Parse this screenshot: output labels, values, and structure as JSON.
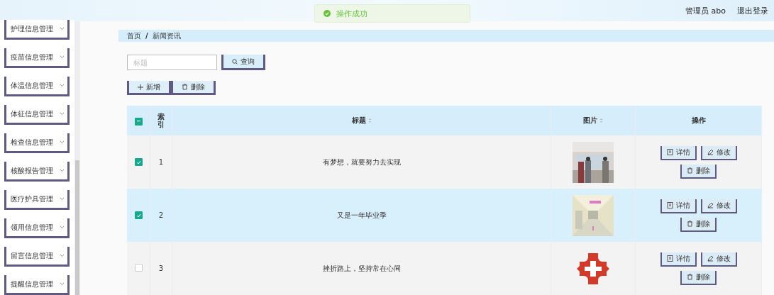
{
  "header": {
    "user": "管理员 abo",
    "logout": "退出登录"
  },
  "toast": {
    "text": "操作成功"
  },
  "sidebar": {
    "items": [
      {
        "label": "护理信息管理"
      },
      {
        "label": "疫苗信息管理"
      },
      {
        "label": "体温信息管理"
      },
      {
        "label": "体征信息管理"
      },
      {
        "label": "检查信息管理"
      },
      {
        "label": "核酸报告管理"
      },
      {
        "label": "医疗护具管理"
      },
      {
        "label": "领用信息管理"
      },
      {
        "label": "留言信息管理"
      },
      {
        "label": "提醒信息管理"
      }
    ]
  },
  "breadcrumb": [
    "首页",
    "新闻资讯"
  ],
  "breadcrumb_separator": "/",
  "search": {
    "placeholder": "标题",
    "button": "查询"
  },
  "actions": [
    "新增",
    "删除"
  ],
  "table": {
    "all_indeterminate": true,
    "columns": [
      "索引",
      "标题",
      "图片",
      "操作"
    ],
    "rows": [
      {
        "checked": true,
        "index": "1",
        "title": "有梦想，就要努力去实现",
        "image": {
          "kind": "picture"
        },
        "buttons": [
          "详情",
          "修改",
          "删除"
        ]
      },
      {
        "checked": true,
        "index": "2",
        "title": "又是一年毕业季",
        "image": {
          "kind": "picture"
        },
        "buttons": [
          "详情",
          "修改",
          "删除"
        ]
      },
      {
        "checked": false,
        "index": "3",
        "title": "挫折路上，坚持常在心间",
        "image": {
          "kind": "logo"
        },
        "buttons": [
          "详情",
          "修改",
          "删除"
        ]
      }
    ]
  }
}
